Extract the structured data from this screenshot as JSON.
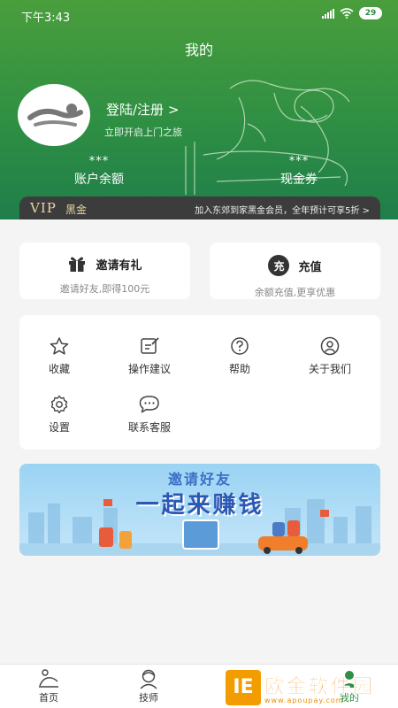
{
  "status": {
    "time": "下午3:43",
    "battery": "29"
  },
  "header": {
    "title": "我的",
    "login": "登陆/注册 >",
    "subtitle": "立即开启上门之旅",
    "stats": [
      {
        "value": "***",
        "label": "账户余额"
      },
      {
        "value": "***",
        "label": "现金券"
      }
    ]
  },
  "vip": {
    "logo": "VIP",
    "level": "黑金",
    "promo": "加入东郊到家黑金会员，全年预计可享5折 >"
  },
  "actions": [
    {
      "title": "邀请有礼",
      "sub": "邀请好友,即得100元"
    },
    {
      "title": "充值",
      "icon_text": "充",
      "sub": "余额充值,更享优惠"
    }
  ],
  "menu": [
    {
      "label": "收藏",
      "icon": "star-icon"
    },
    {
      "label": "操作建议",
      "icon": "edit-icon"
    },
    {
      "label": "帮助",
      "icon": "help-icon"
    },
    {
      "label": "关于我们",
      "icon": "user-icon"
    },
    {
      "label": "设置",
      "icon": "gear-icon"
    },
    {
      "label": "联系客服",
      "icon": "chat-icon"
    }
  ],
  "banner": {
    "top": "邀请好友",
    "main": "一起来赚钱"
  },
  "tabs": [
    {
      "label": "首页",
      "icon": "massage-icon"
    },
    {
      "label": "技师",
      "icon": "technician-icon"
    },
    {
      "label": "我的",
      "icon": "profile-icon"
    }
  ],
  "watermark": {
    "logo": "IE",
    "big": "欧金软件园",
    "small": "www.apoupay.com"
  },
  "colors": {
    "primary": "#2f8f43",
    "vip_bar": "#3c3c3c",
    "vip_text": "#e8d4a3"
  }
}
